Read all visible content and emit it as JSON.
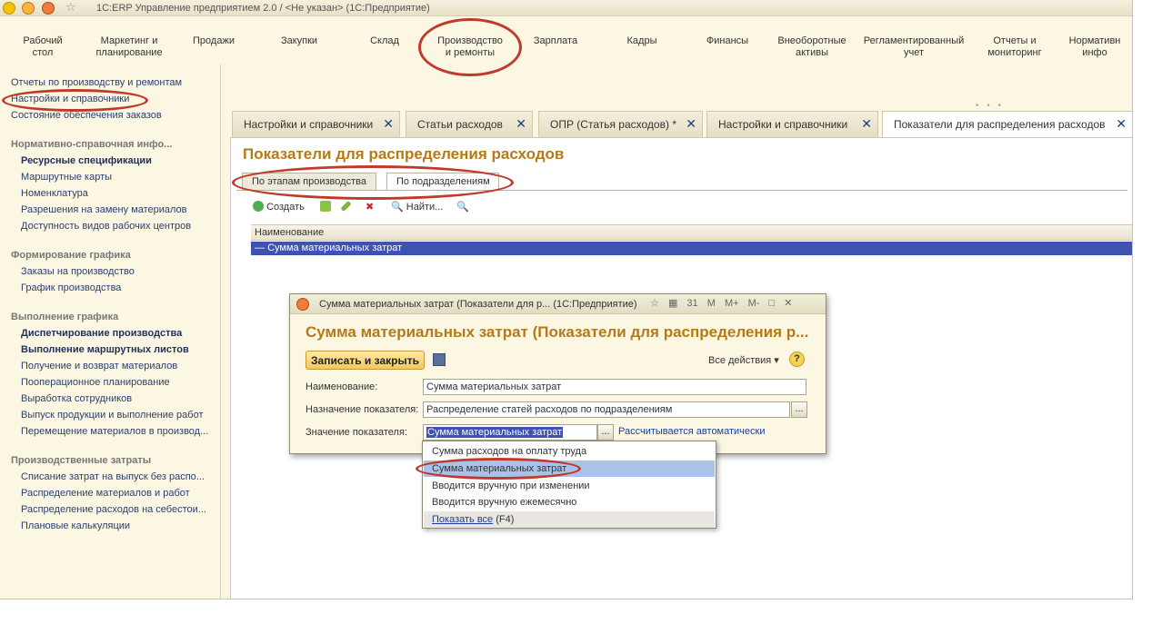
{
  "window": {
    "title": "1С:ERP Управление предприятием 2.0 / <Не указан>  (1С:Предприятие)"
  },
  "sections": [
    {
      "label": "Рабочий\nстол"
    },
    {
      "label": "Маркетинг и\nпланирование"
    },
    {
      "label": "Продажи"
    },
    {
      "label": "Закупки"
    },
    {
      "label": "Склад"
    },
    {
      "label": "Производство\nи ремонты"
    },
    {
      "label": "Зарплата"
    },
    {
      "label": "Кадры"
    },
    {
      "label": "Финансы"
    },
    {
      "label": "Внеоборотные\nактивы"
    },
    {
      "label": "Регламентированный\nучет"
    },
    {
      "label": "Отчеты и\nмониторинг"
    },
    {
      "label": "Нормативн\nинфо"
    }
  ],
  "sidebar": {
    "top_links": [
      "Отчеты по производству и ремонтам",
      "Настройки и справочники",
      "Состояние обеспечения заказов"
    ],
    "groups": [
      {
        "title": "Нормативно-справочная инфо...",
        "items": [
          "Ресурсные спецификации",
          "Маршрутные карты",
          "Номенклатура",
          "Разрешения на замену материалов",
          "Доступность видов рабочих центров"
        ]
      },
      {
        "title": "Формирование графика",
        "items": [
          "Заказы на производство",
          "График производства"
        ]
      },
      {
        "title": "Выполнение графика",
        "items": [
          "Диспетчирование производства",
          "Выполнение маршрутных листов",
          "Получение и возврат материалов",
          "Пооперационное планирование",
          "Выработка сотрудников",
          "Выпуск продукции и выполнение работ",
          "Перемещение материалов в производ..."
        ]
      },
      {
        "title": "Производственные затраты",
        "items": [
          "Списание затрат на выпуск без распо...",
          "Распределение материалов и работ",
          "Распределение расходов на себестои...",
          "Плановые калькуляции"
        ]
      }
    ]
  },
  "tabs": [
    {
      "label": "Настройки и справочники"
    },
    {
      "label": "Статьи расходов"
    },
    {
      "label": "ОПР (Статья расходов) *"
    },
    {
      "label": "Настройки и справочники"
    },
    {
      "label": "Показатели для распределения расходов"
    }
  ],
  "list_form": {
    "title": "Показатели для распределения расходов",
    "subtabs": [
      "По этапам производства",
      "По подразделениям"
    ],
    "toolbar": {
      "create": "Создать",
      "find": "Найти..."
    },
    "grid": {
      "column": "Наименование",
      "rows": [
        "Сумма материальных затрат"
      ]
    }
  },
  "dialog": {
    "window_title": "Сумма материальных затрат (Показатели для р...  (1С:Предприятие)",
    "window_icons": [
      "☆",
      "▦",
      "31",
      "M",
      "M+",
      "M-",
      "□",
      "✕"
    ],
    "heading": "Сумма материальных затрат (Показатели для распределения р...",
    "save_close": "Записать и закрыть",
    "all_actions": "Все действия ▾",
    "help": "?",
    "fields": [
      {
        "label": "Наименование:",
        "value": "Сумма материальных затрат"
      },
      {
        "label": "Назначение показателя:",
        "value": "Распределение статей расходов по подразделениям"
      },
      {
        "label": "Значение показателя:",
        "value": "Сумма материальных затрат"
      }
    ],
    "dots": "...",
    "auto_link": "Рассчитывается автоматически"
  },
  "dropdown": {
    "options": [
      "Сумма расходов на оплату труда",
      "Сумма материальных затрат",
      "Вводится вручную при изменении",
      "Вводится вручную ежемесячно"
    ],
    "selected": "Сумма материальных затрат",
    "show_all": "Показать все",
    "show_all_key": "(F4)"
  },
  "colors": {
    "accent_title": "#b57a17",
    "selection": "#3e52b1",
    "annotation": "#c0392b",
    "background": "#fbf7e3"
  }
}
